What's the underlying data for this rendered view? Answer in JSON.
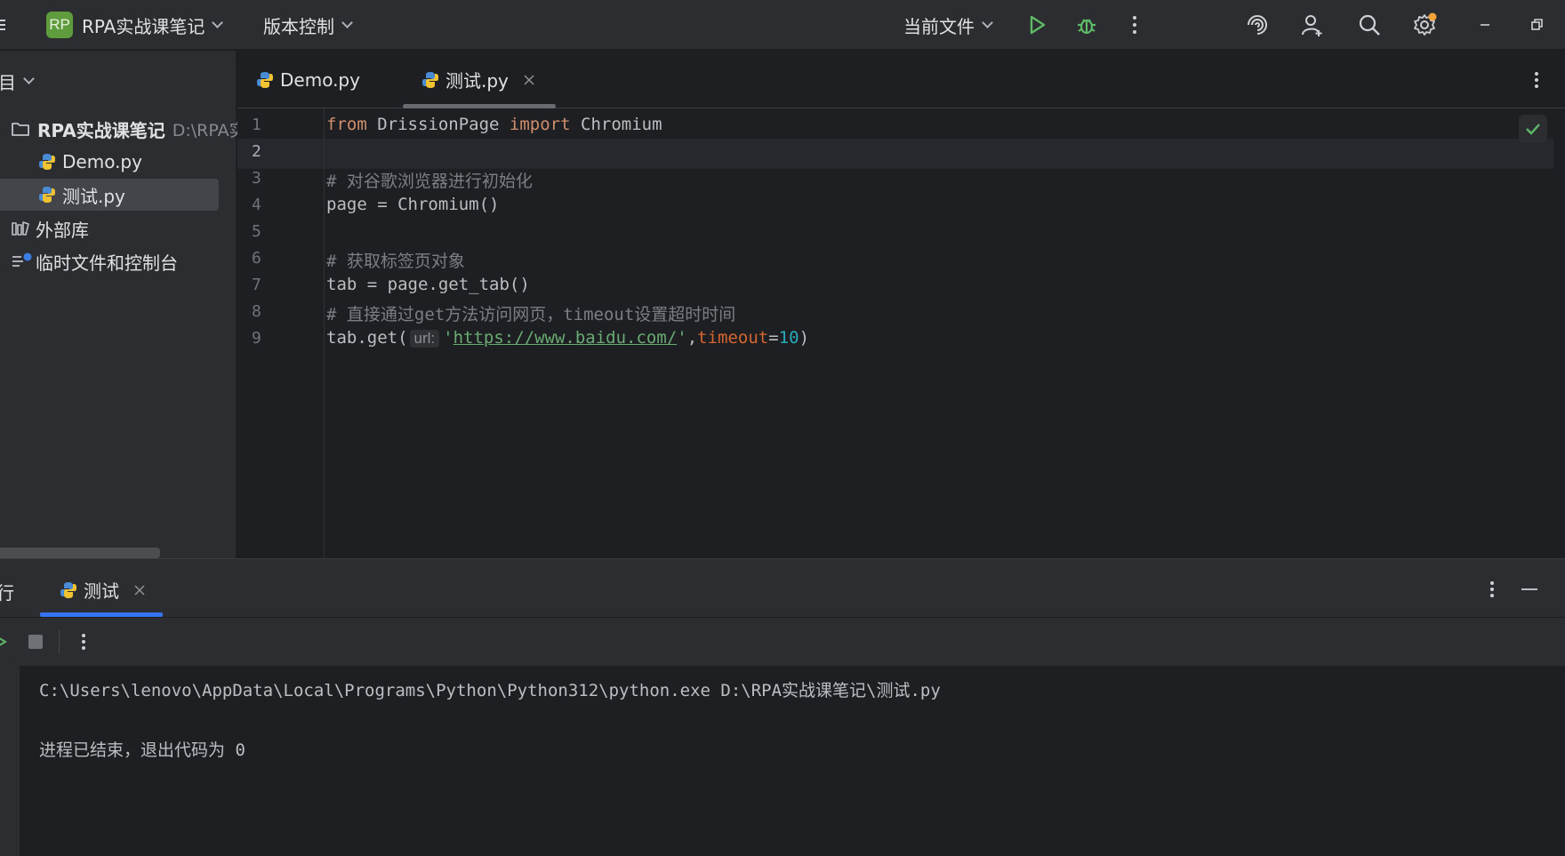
{
  "titlebar": {
    "project_badge": "RP",
    "project_name": "RPA实战课笔记",
    "vcs_label": "版本控制",
    "run_config": "当前文件"
  },
  "project_panel": {
    "header": "目",
    "root_name": "RPA实战课笔记",
    "root_path": "D:\\RPA实",
    "files": [
      "Demo.py",
      "测试.py"
    ],
    "external_libs": "外部库",
    "scratches": "临时文件和控制台"
  },
  "editor": {
    "tabs": [
      {
        "label": "Demo.py"
      },
      {
        "label": "测试.py"
      }
    ],
    "line_numbers": [
      "1",
      "2",
      "3",
      "4",
      "5",
      "6",
      "7",
      "8",
      "9"
    ],
    "code": {
      "l1_kw1": "from",
      "l1_mod": " DrissionPage ",
      "l1_kw2": "import",
      "l1_name": " Chromium",
      "l3": "# 对谷歌浏览器进行初始化",
      "l4": "page = Chromium()",
      "l6": "# 获取标签页对象",
      "l7": "tab = page.get_tab()",
      "l8": "# 直接通过get方法访问网页，timeout设置超时时间",
      "l9_pre": "tab.get(",
      "l9_hint": "url:",
      "l9_q1": "'",
      "l9_url": "https://www.baidu.com/",
      "l9_q2": "'",
      "l9_comma": ",",
      "l9_param": "timeout",
      "l9_eq": "=",
      "l9_num": "10",
      "l9_close": ")"
    }
  },
  "run_panel": {
    "title": "行",
    "tab_label": "测试",
    "console": [
      "C:\\Users\\lenovo\\AppData\\Local\\Programs\\Python\\Python312\\python.exe D:\\RPA实战课笔记\\测试.py",
      "进程已结束，退出代码为 0"
    ]
  }
}
